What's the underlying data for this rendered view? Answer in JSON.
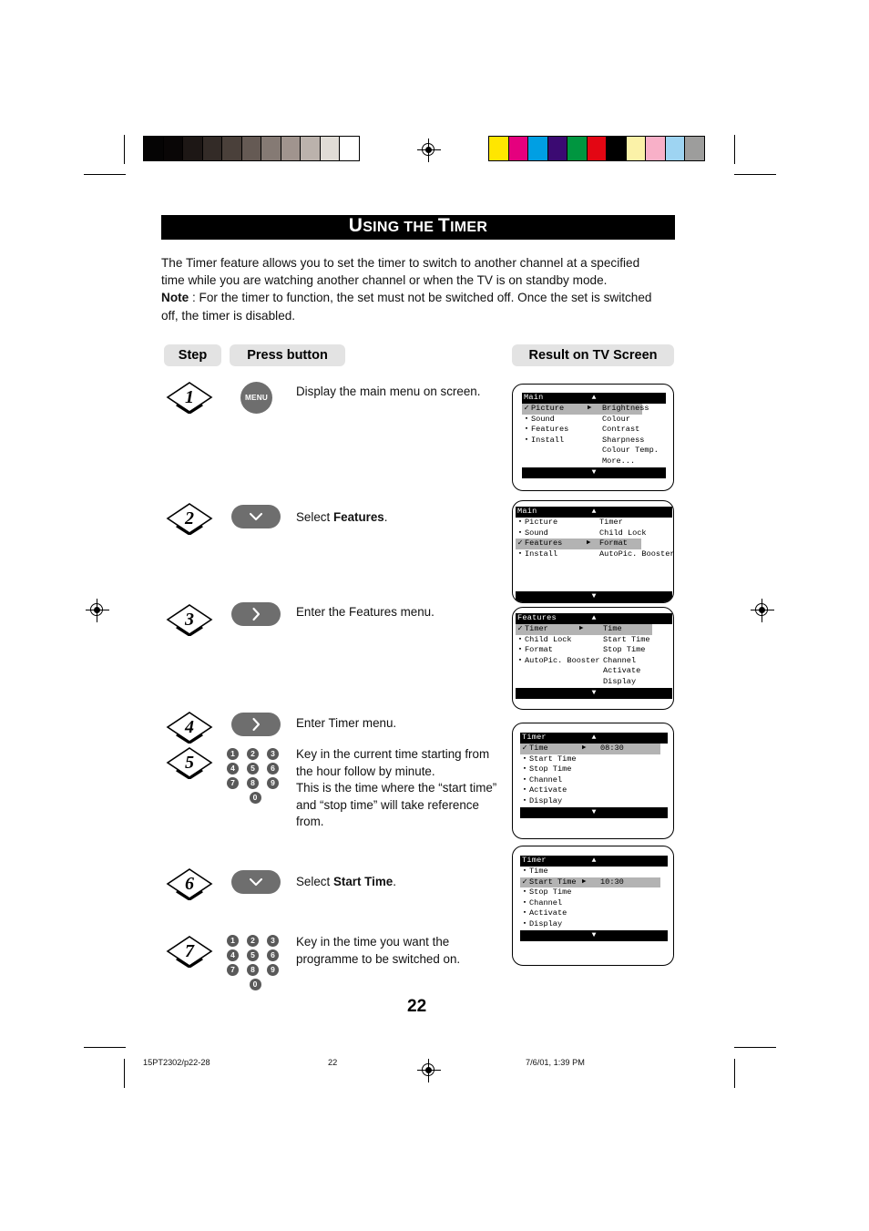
{
  "page": {
    "title_word1": "U",
    "title_rest1": "SING THE ",
    "title_word2": "T",
    "title_rest2": "IMER",
    "title_full": "USING THE TIMER",
    "page_number": "22"
  },
  "intro": {
    "line1": "The Timer feature allows you to set the timer to switch to another channel at a specified",
    "line2": "time while you are watching another channel or when the TV is on standby mode.",
    "note_label": "Note",
    "line3": " : For the timer to function, the set must not be switched off. Once the set is switched",
    "line4": "off, the timer is disabled."
  },
  "headers": {
    "step": "Step",
    "press_button": "Press button",
    "result": "Result on TV Screen"
  },
  "steps": [
    {
      "number": "1",
      "button_kind": "menu",
      "button_label": "MENU",
      "instruction": "Display the main menu on screen."
    },
    {
      "number": "2",
      "button_kind": "down",
      "button_label": "∨",
      "instruction_pre": "Select ",
      "instruction_bold": "Features",
      "instruction_post": "."
    },
    {
      "number": "3",
      "button_kind": "right",
      "button_label": ">",
      "instruction": "Enter the Features menu."
    },
    {
      "number": "4",
      "button_kind": "right",
      "button_label": ">",
      "instruction": "Enter Timer menu."
    },
    {
      "number": "5",
      "button_kind": "keypad",
      "instruction_lines": [
        "Key in the current time starting from",
        "the hour follow by minute.",
        "This is the time where the “start time”",
        "and “stop time” will take reference",
        "from."
      ]
    },
    {
      "number": "6",
      "button_kind": "down",
      "button_label": "∨",
      "instruction_pre": "Select ",
      "instruction_bold": "Start Time",
      "instruction_post": "."
    },
    {
      "number": "7",
      "button_kind": "keypad",
      "instruction_lines": [
        "Key in the time you want the",
        "programme to be switched on."
      ]
    }
  ],
  "keypad": {
    "keys": [
      "1",
      "2",
      "3",
      "4",
      "5",
      "6",
      "7",
      "8",
      "9",
      "0"
    ]
  },
  "tv_screens": [
    {
      "id": "screen-main-picture",
      "title": "Main",
      "up_arrow": "▲",
      "down_arrow": "▼",
      "left_items": [
        {
          "marker": "check",
          "label": "Picture",
          "arrow": "▶",
          "highlight": true
        },
        {
          "marker": "bullet",
          "label": "Sound",
          "arrow": "",
          "highlight": false
        },
        {
          "marker": "bullet",
          "label": "Features",
          "arrow": "",
          "highlight": false
        },
        {
          "marker": "bullet",
          "label": "Install",
          "arrow": "",
          "highlight": false
        }
      ],
      "right_items": [
        "Brightness",
        "Colour",
        "Contrast",
        "Sharpness",
        "Colour Temp.",
        "More..."
      ]
    },
    {
      "id": "screen-main-features",
      "title": "Main",
      "up_arrow": "▲",
      "down_arrow": "▼",
      "left_items": [
        {
          "marker": "bullet",
          "label": "Picture",
          "arrow": "",
          "highlight": false
        },
        {
          "marker": "bullet",
          "label": "Sound",
          "arrow": "",
          "highlight": false
        },
        {
          "marker": "check",
          "label": "Features",
          "arrow": "▶",
          "highlight": true
        },
        {
          "marker": "bullet",
          "label": "Install",
          "arrow": "",
          "highlight": false
        }
      ],
      "right_items": [
        "Timer",
        "Child Lock",
        "Format",
        "AutoPic. Booster"
      ]
    },
    {
      "id": "screen-features-timer",
      "title": "Features",
      "up_arrow": "▲",
      "down_arrow": "▼",
      "left_items": [
        {
          "marker": "check",
          "label": "Timer",
          "arrow": "▶",
          "highlight": true
        },
        {
          "marker": "bullet",
          "label": "Child Lock",
          "arrow": "",
          "highlight": false
        },
        {
          "marker": "bullet",
          "label": "Format",
          "arrow": "",
          "highlight": false
        },
        {
          "marker": "bullet",
          "label": "AutoPic. Booster",
          "arrow": "",
          "highlight": false
        }
      ],
      "right_items": [
        "Time",
        "Start Time",
        "Stop Time",
        "Channel",
        "Activate",
        "Display"
      ]
    },
    {
      "id": "screen-timer-time",
      "title": "Timer",
      "up_arrow": "▲",
      "down_arrow": "▼",
      "left_items": [
        {
          "marker": "check",
          "label": "Time",
          "arrow": "▶",
          "value": "08:30",
          "highlight": true
        },
        {
          "marker": "bullet",
          "label": "Start Time",
          "arrow": "",
          "highlight": false
        },
        {
          "marker": "bullet",
          "label": "Stop Time",
          "arrow": "",
          "highlight": false
        },
        {
          "marker": "bullet",
          "label": "Channel",
          "arrow": "",
          "highlight": false
        },
        {
          "marker": "bullet",
          "label": "Activate",
          "arrow": "",
          "highlight": false
        },
        {
          "marker": "bullet",
          "label": "Display",
          "arrow": "",
          "highlight": false
        }
      ],
      "right_items": []
    },
    {
      "id": "screen-timer-start-time",
      "title": "Timer",
      "up_arrow": "▲",
      "down_arrow": "▼",
      "left_items": [
        {
          "marker": "bullet",
          "label": "Time",
          "arrow": "",
          "highlight": false
        },
        {
          "marker": "check",
          "label": "Start Time",
          "arrow": "▶",
          "value": "10:30",
          "highlight": true
        },
        {
          "marker": "bullet",
          "label": "Stop Time",
          "arrow": "",
          "highlight": false
        },
        {
          "marker": "bullet",
          "label": "Channel",
          "arrow": "",
          "highlight": false
        },
        {
          "marker": "bullet",
          "label": "Activate",
          "arrow": "",
          "highlight": false
        },
        {
          "marker": "bullet",
          "label": "Display",
          "arrow": "",
          "highlight": false
        }
      ],
      "right_items": []
    }
  ],
  "print_marks": {
    "grayscale_swatches": [
      "#050404",
      "#090606",
      "#1d1715",
      "#332b27",
      "#4a403a",
      "#655a54",
      "#857a74",
      "#a0948e",
      "#bbb2ac",
      "#e0dcd6",
      "#ffffff"
    ],
    "colour_swatches": [
      "#ffe600",
      "#e5007e",
      "#009fe3",
      "#3b0a72",
      "#009640",
      "#e30613",
      "#000000",
      "#fbf2a8",
      "#f8b0c8",
      "#9ed4f2",
      "#9d9d9c"
    ]
  },
  "footer": {
    "file": "15PT2302/p22-28",
    "page": "22",
    "timestamp": "7/6/01, 1:39 PM"
  }
}
